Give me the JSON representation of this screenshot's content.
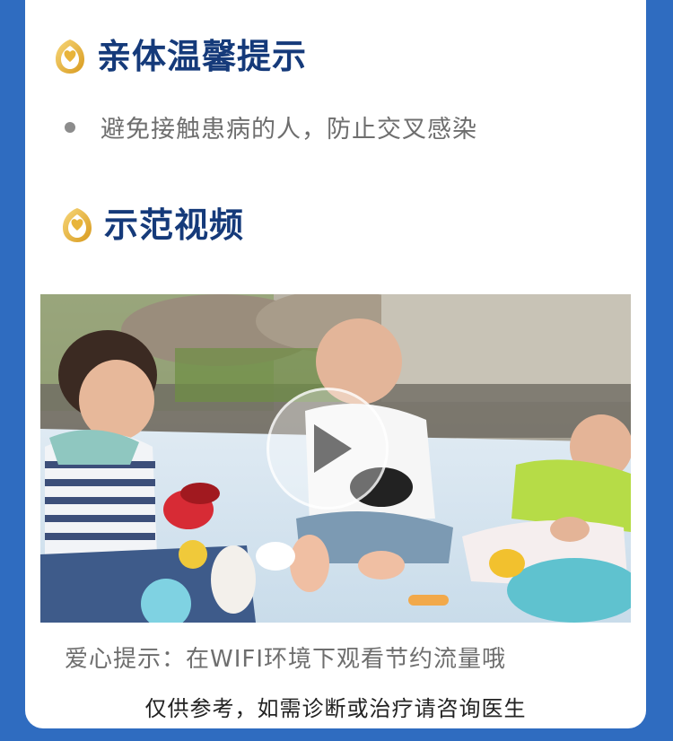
{
  "sections": {
    "care_tips": {
      "title": "亲体温馨提示",
      "icon": "care-logo-icon",
      "items": [
        "避免接触患病的人，防止交叉感染"
      ]
    },
    "demo_video": {
      "title": "示范视频",
      "icon": "care-logo-icon",
      "video": {
        "play_icon": "play-icon",
        "thumbnail": "babies-playing-outdoors"
      }
    }
  },
  "wifi_tip": "爱心提示：在WIFI环境下观看节约流量哦",
  "disclaimer": "仅供参考，如需诊断或治疗请咨询医生",
  "colors": {
    "background": "#2f6cc0",
    "card": "#ffffff",
    "title": "#153a7a",
    "icon_gold": "#e8b43a",
    "body_text": "#6e6e6e"
  }
}
